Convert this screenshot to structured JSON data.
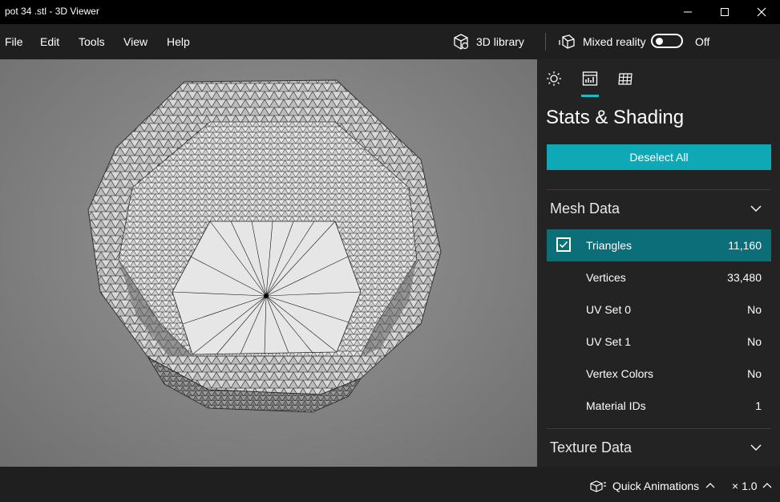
{
  "window": {
    "title": "pot 34 .stl - 3D Viewer"
  },
  "menu": {
    "items": [
      "File",
      "Edit",
      "Tools",
      "View",
      "Help"
    ]
  },
  "toolbar": {
    "library_label": "3D library",
    "mixed_reality_label": "Mixed reality",
    "mixed_reality_state": "Off"
  },
  "panel": {
    "tabs": [
      {
        "icon": "sun-icon",
        "label": "Environment"
      },
      {
        "icon": "stats-icon",
        "label": "Stats & Shading"
      },
      {
        "icon": "grid-icon",
        "label": "Grid"
      }
    ],
    "active_tab": 1,
    "title": "Stats & Shading",
    "deselect_label": "Deselect All",
    "mesh_section": "Mesh Data",
    "rows": [
      {
        "label": "Triangles",
        "value": "11,160",
        "checked": true
      },
      {
        "label": "Vertices",
        "value": "33,480"
      },
      {
        "label": "UV Set 0",
        "value": "No"
      },
      {
        "label": "UV Set 1",
        "value": "No"
      },
      {
        "label": "Vertex Colors",
        "value": "No"
      },
      {
        "label": "Material IDs",
        "value": "1"
      }
    ],
    "texture_section": "Texture Data"
  },
  "statusbar": {
    "quick_animations": "Quick Animations",
    "zoom": "× 1.0"
  },
  "colors": {
    "accent": "#0fa8b7",
    "selected_row": "#0c6e78",
    "background": "#1f1f1f"
  }
}
